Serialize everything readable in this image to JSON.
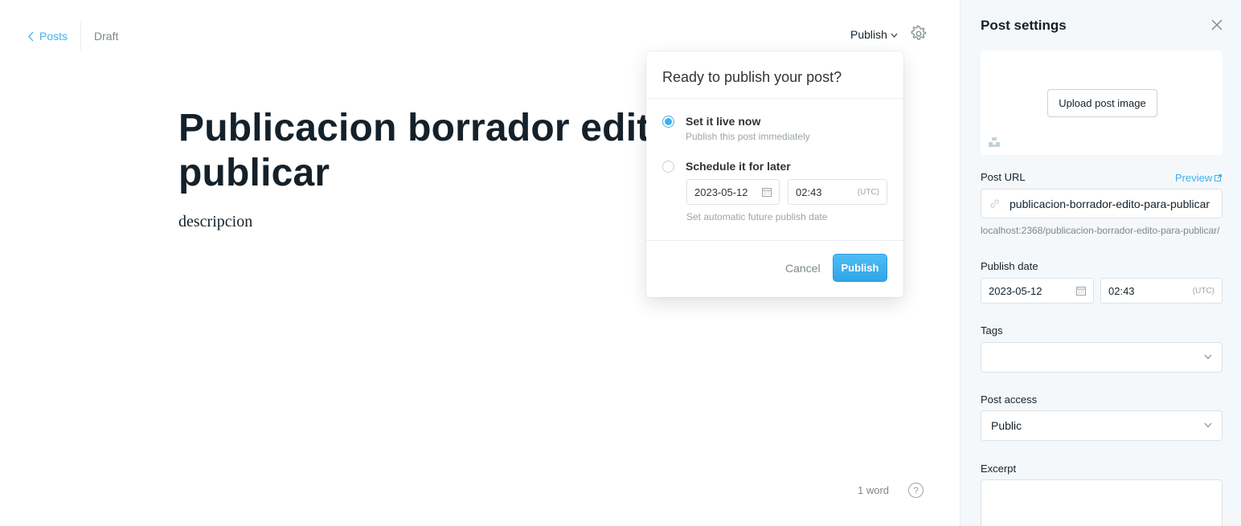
{
  "editor": {
    "back_label": "Posts",
    "status": "Draft",
    "publish_trigger_label": "Publish",
    "title": "Publicacion borrador edito para publicar",
    "body": "descripcion",
    "word_count": "1 word",
    "help_label": "?"
  },
  "publish_menu": {
    "header": "Ready to publish your post?",
    "option_now_title": "Set it live now",
    "option_now_desc": "Publish this post immediately",
    "option_later_title": "Schedule it for later",
    "date": "2023-05-12",
    "time": "02:43",
    "timezone": "(UTC)",
    "hint": "Set automatic future publish date",
    "cancel_label": "Cancel",
    "publish_label": "Publish",
    "selected_option": "now"
  },
  "settings": {
    "title": "Post settings",
    "upload_label": "Upload post image",
    "post_url_label": "Post URL",
    "preview_label": "Preview",
    "slug": "publicacion-borrador-edito-para-publicar",
    "full_url": "localhost:2368/publicacion-borrador-edito-para-publicar/",
    "publish_date_label": "Publish date",
    "publish_date": "2023-05-12",
    "publish_time": "02:43",
    "timezone": "(UTC)",
    "tags_label": "Tags",
    "post_access_label": "Post access",
    "post_access_value": "Public",
    "excerpt_label": "Excerpt"
  },
  "colors": {
    "accent": "#3eb0ef",
    "text": "#15212a",
    "muted": "#7d878a",
    "panel_bg": "#f4f8fb"
  },
  "icons": [
    "chevron-left-icon",
    "chevron-down-icon",
    "gear-icon",
    "question-icon",
    "calendar-icon",
    "close-icon",
    "link-icon",
    "external-link-icon",
    "unsplash-icon"
  ]
}
